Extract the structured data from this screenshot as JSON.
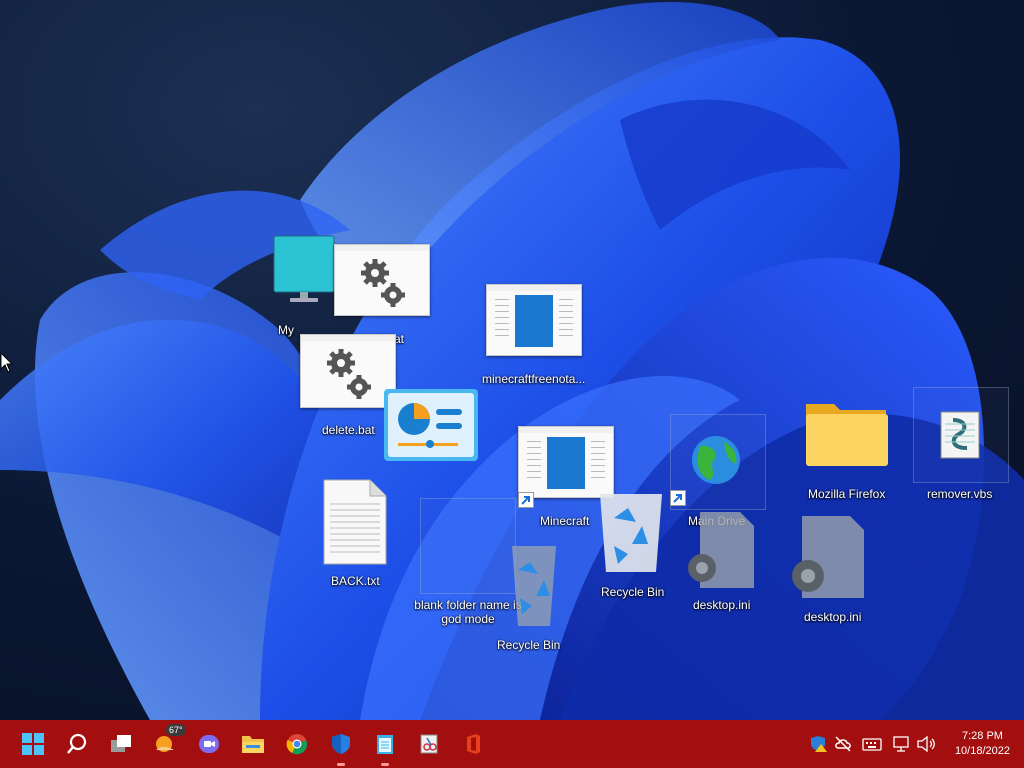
{
  "desktop": {
    "icons": {
      "this_pc": "My",
      "bat_file_1": "at",
      "delete_bat": "delete.bat",
      "minecraft_free": "minecraftfreenota...",
      "minecraft": "Minecraft",
      "main_drive": "Main Drive",
      "mozilla_firefox": "Mozilla Firefox",
      "remover_vbs": "remover.vbs",
      "back_txt": "BACK.txt",
      "blank_folder": "blank folder name is god mode",
      "recycle_bin_1": "Recycle Bin",
      "recycle_bin_2": "Recycle Bin",
      "desktop_ini_1": "desktop.ini",
      "desktop_ini_2": "desktop.ini"
    }
  },
  "taskbar": {
    "weather_temp": "67°",
    "clock_time": "7:28 PM",
    "clock_date": "10/18/2022",
    "color": "#a30f0f"
  }
}
